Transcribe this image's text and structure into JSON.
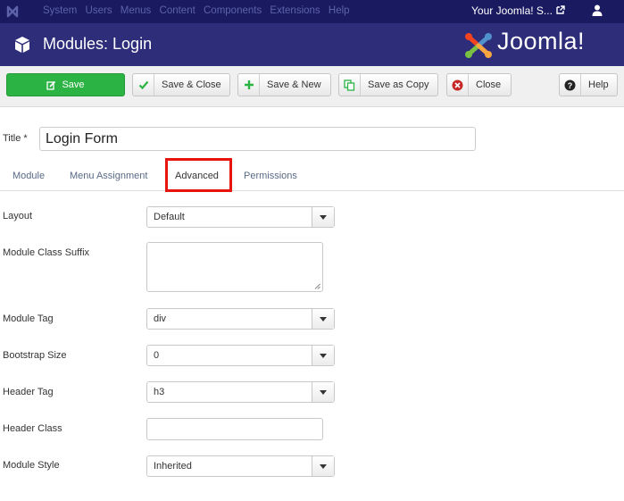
{
  "topnav": {
    "menu": [
      "System",
      "Users",
      "Menus",
      "Content",
      "Components",
      "Extensions",
      "Help"
    ],
    "site_link": "Your Joomla! S...",
    "icons": [
      "joomla-logo-icon",
      "external-link-icon",
      "user-icon"
    ]
  },
  "header": {
    "title": "Modules: Login",
    "brand": "Joomla!",
    "icons": [
      "cube-icon"
    ]
  },
  "toolbar": {
    "save": "Save",
    "save_close": "Save & Close",
    "save_new": "Save & New",
    "save_copy": "Save as Copy",
    "close": "Close",
    "help": "Help"
  },
  "form_title": {
    "label": "Title *",
    "value": "Login Form"
  },
  "tabs": {
    "module": "Module",
    "menu_assignment": "Menu Assignment",
    "advanced": "Advanced",
    "permissions": "Permissions",
    "active": "Advanced"
  },
  "fields": {
    "layout": {
      "label": "Layout",
      "value": "Default"
    },
    "module_class_suffix": {
      "label": "Module Class Suffix",
      "value": ""
    },
    "module_tag": {
      "label": "Module Tag",
      "value": "div"
    },
    "bootstrap_size": {
      "label": "Bootstrap Size",
      "value": "0"
    },
    "header_tag": {
      "label": "Header Tag",
      "value": "h3"
    },
    "header_class": {
      "label": "Header Class",
      "value": ""
    },
    "module_style": {
      "label": "Module Style",
      "value": "Inherited"
    }
  },
  "colors": {
    "topnav": "#1a1a61",
    "header": "#2e2d7a",
    "save_button": "#2bb344",
    "highlight": "#e8140e"
  }
}
